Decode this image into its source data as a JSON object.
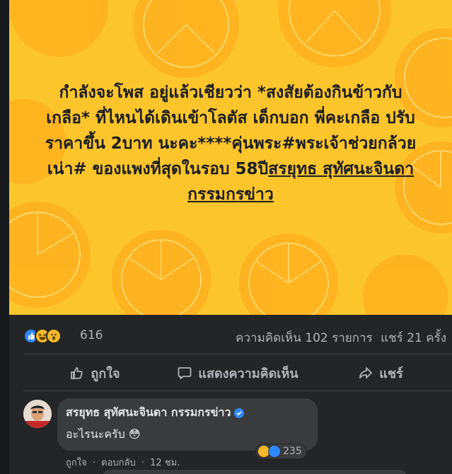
{
  "post": {
    "text_plain": "กำลังจะโพส อยู่แล้วเชียวว่า *สงสัยต้องกินข้าวกับเกลือ* ที่ไหนได้เดินเข้าโลตัส เด็กบอก พี่คะเกลือ ปรับราคาขึ้น 2บาท นะคะ****คุ่นพระ#พระเจ้าช่วยกล้วยเน่า# ของแพงที่สุดในรอบ 58ปี",
    "tag": "สรยุทธ สุทัศนะจินดา กรรมกรข่าว",
    "background": "#fdc52c"
  },
  "stats": {
    "reaction_count": "616",
    "comments": "ความคิดเห็น 102 รายการ",
    "shares": "แชร์ 21 ครั้ง"
  },
  "actions": {
    "like": "ถูกใจ",
    "comment": "แสดงความคิดเห็น",
    "share": "แชร์"
  },
  "comment": {
    "author": "สรยุทธ สุทัศนะจินดา กรรมกรข่าว",
    "text": "อะไรนะครับ 😳",
    "reaction_count": "235",
    "like_label": "ถูกใจ",
    "reply_label": "ตอบกลับ",
    "time": "12 ชม."
  },
  "colors": {
    "accent": "#2d88ff",
    "surface": "#242526",
    "bubble": "#3a3b3c"
  }
}
